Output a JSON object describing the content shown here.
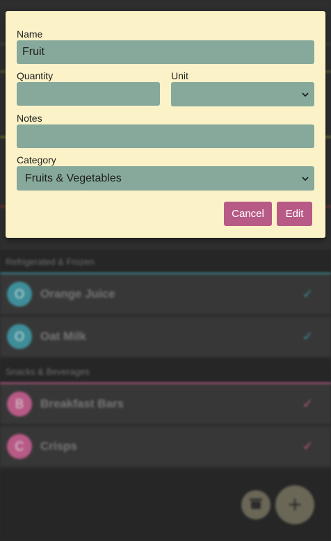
{
  "dialog": {
    "name_label": "Name",
    "name_value": "Fruit",
    "quantity_label": "Quantity",
    "quantity_value": "",
    "unit_label": "Unit",
    "unit_value": "",
    "notes_label": "Notes",
    "notes_value": "",
    "category_label": "Category",
    "category_value": "Fruits & Vegetables",
    "cancel_label": "Cancel",
    "edit_label": "Edit"
  },
  "background": {
    "sections": [
      {
        "title": "Refrigerated & Frozen",
        "color": "#3e8e9a",
        "items": [
          {
            "initial": "O",
            "label": "Orange Juice"
          },
          {
            "initial": "O",
            "label": "Oat Milk"
          }
        ]
      },
      {
        "title": "Snacks & Beverages",
        "color": "#b85a86",
        "items": [
          {
            "initial": "B",
            "label": "Breakfast Bars"
          },
          {
            "initial": "C",
            "label": "Crisps"
          }
        ]
      }
    ],
    "check_icon": "check-icon",
    "archive_icon": "archive-icon",
    "add_icon": "plus-icon"
  },
  "colors": {
    "dialog_bg": "#fbf2c8",
    "field_bg": "#86a99b",
    "button_bg": "#b85a86",
    "teal_accent": "#3e8e9a",
    "pink_accent": "#b85a86"
  }
}
